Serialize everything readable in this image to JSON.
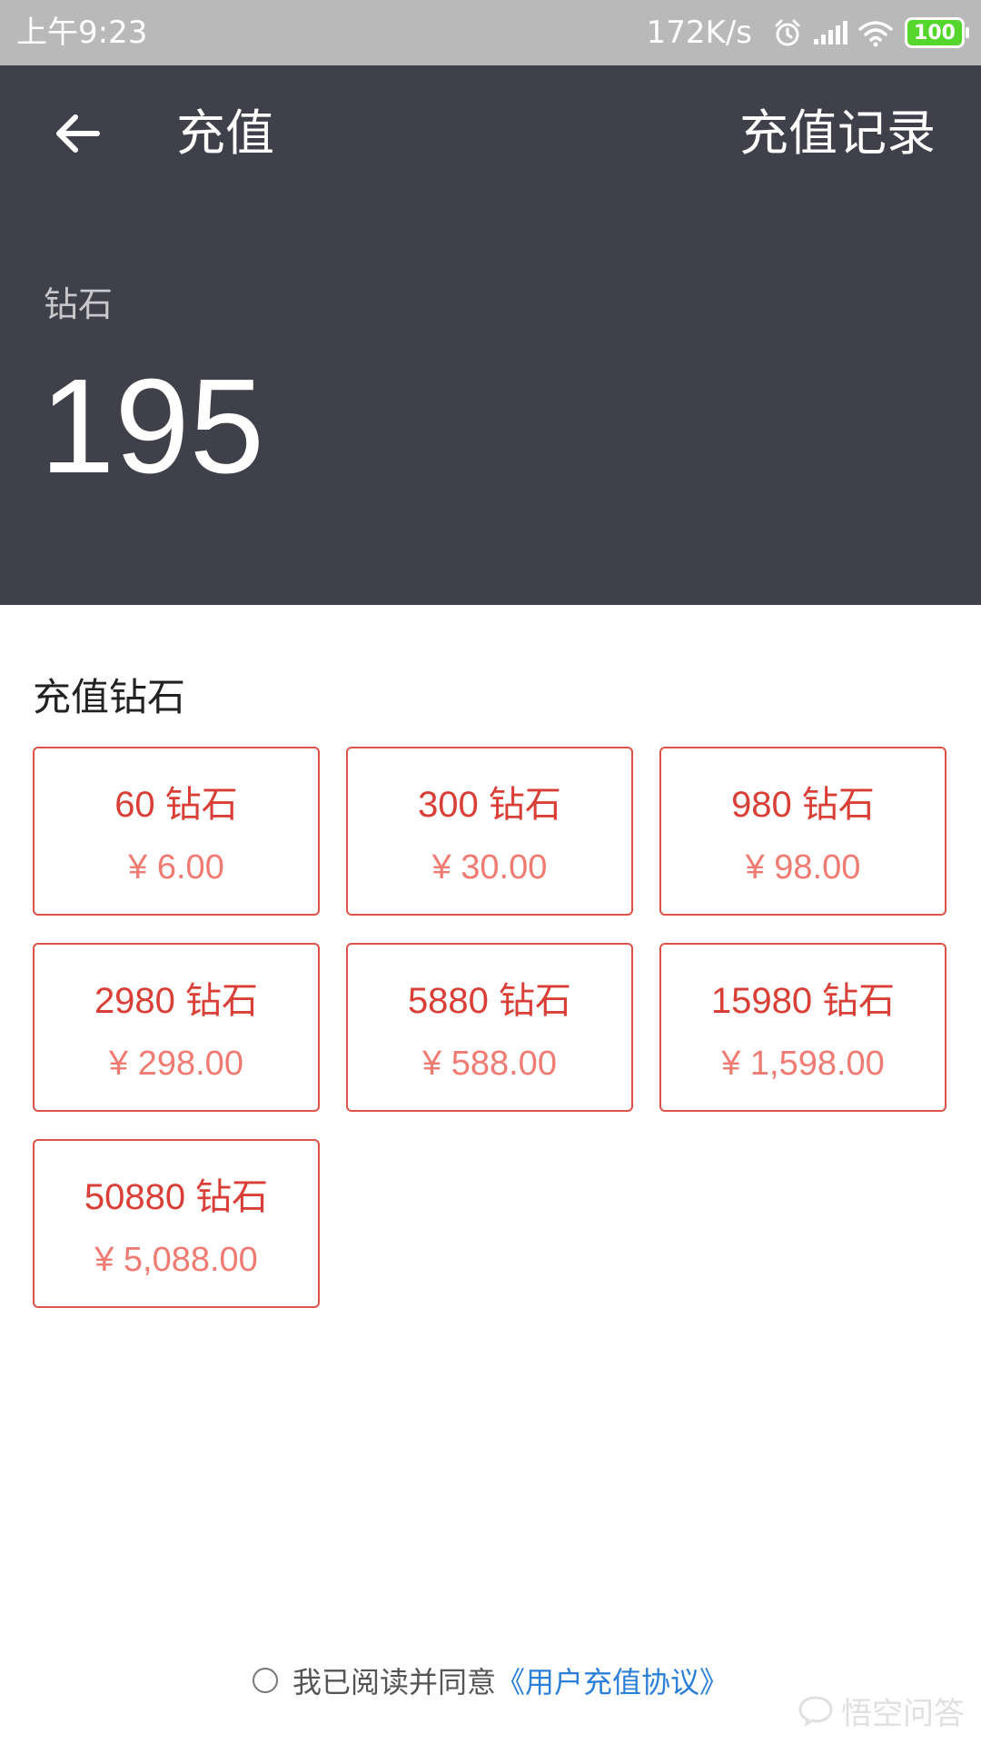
{
  "status_bar": {
    "time": "上午9:23",
    "network_speed": "172K/s",
    "battery_level": "100",
    "icons": [
      "alarm-icon",
      "signal-icon",
      "wifi-icon",
      "battery-icon"
    ]
  },
  "header": {
    "title": "充值",
    "records_label": "充值记录",
    "back_icon": "back-arrow-icon",
    "balance_label": "钻石",
    "balance_value": "195",
    "background_color": "#40404b"
  },
  "section": {
    "title": "充值钻石"
  },
  "packages": [
    {
      "amount": "60 钻石",
      "price": "¥ 6.00"
    },
    {
      "amount": "300 钻石",
      "price": "¥ 30.00"
    },
    {
      "amount": "980 钻石",
      "price": "¥ 98.00"
    },
    {
      "amount": "2980 钻石",
      "price": "¥ 298.00"
    },
    {
      "amount": "5880 钻石",
      "price": "¥ 588.00"
    },
    {
      "amount": "15980 钻石",
      "price": "¥ 1,598.00"
    },
    {
      "amount": "50880 钻石",
      "price": "¥ 5,088.00"
    }
  ],
  "agreement": {
    "text": "我已阅读并同意",
    "link": "《用户充值协议》"
  },
  "watermark": {
    "text": "悟空问答"
  },
  "colors": {
    "accent_red": "#d93f36",
    "price_red": "#ef7b73",
    "link_blue": "#2b7fd9",
    "battery_green": "#54d62c"
  }
}
